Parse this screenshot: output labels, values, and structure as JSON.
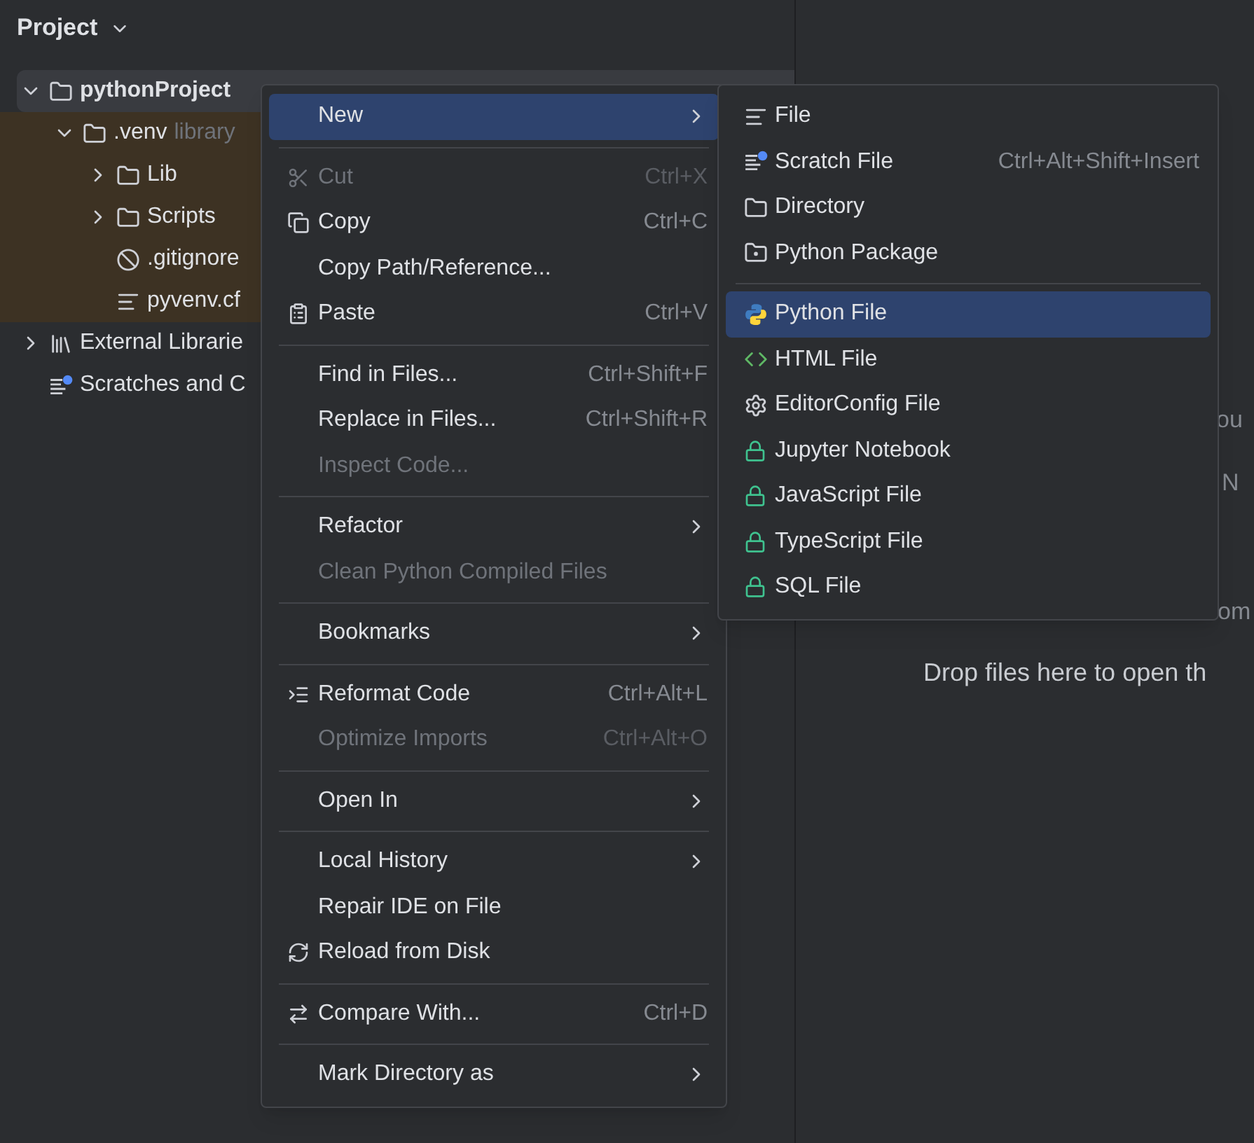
{
  "panel": {
    "title": "Project"
  },
  "tree": [
    {
      "label": "pythonProject",
      "kind": "folder",
      "expanded": true,
      "selected": true,
      "children": [
        {
          "label": ".venv",
          "hint": "library",
          "kind": "folder",
          "expanded": true,
          "selected": false,
          "excluded": true,
          "children": [
            {
              "label": "Lib",
              "kind": "folder",
              "expanded": false,
              "selected": false
            },
            {
              "label": "Scripts",
              "kind": "folder",
              "expanded": false,
              "selected": false
            },
            {
              "label": ".gitignore",
              "kind": "ignore",
              "selected": false
            },
            {
              "label": "pyvenv.cf",
              "kind": "text",
              "selected": false
            }
          ]
        }
      ]
    },
    {
      "label": "External Librarie",
      "kind": "library",
      "expanded": false,
      "selected": false
    },
    {
      "label": "Scratches and C",
      "kind": "scratch",
      "selected": false
    }
  ],
  "context_menu": [
    {
      "kind": "plain",
      "label": "New",
      "submenu": true,
      "disabled": false,
      "selected": true
    },
    {
      "kind": "separator"
    },
    {
      "kind": "cut",
      "label": "Cut",
      "shortcut": "Ctrl+X",
      "disabled": true,
      "selected": false
    },
    {
      "kind": "copy",
      "label": "Copy",
      "shortcut": "Ctrl+C",
      "disabled": false,
      "selected": false
    },
    {
      "kind": "plain",
      "label": "Copy Path/Reference...",
      "disabled": false,
      "selected": false
    },
    {
      "kind": "paste",
      "label": "Paste",
      "shortcut": "Ctrl+V",
      "disabled": false,
      "selected": false
    },
    {
      "kind": "separator"
    },
    {
      "kind": "plain",
      "label": "Find in Files...",
      "shortcut": "Ctrl+Shift+F",
      "disabled": false,
      "selected": false
    },
    {
      "kind": "plain",
      "label": "Replace in Files...",
      "shortcut": "Ctrl+Shift+R",
      "disabled": false,
      "selected": false
    },
    {
      "kind": "plain",
      "label": "Inspect Code...",
      "disabled": true,
      "selected": false
    },
    {
      "kind": "separator"
    },
    {
      "kind": "plain",
      "label": "Refactor",
      "submenu": true,
      "disabled": false,
      "selected": false
    },
    {
      "kind": "plain",
      "label": "Clean Python Compiled Files",
      "disabled": true,
      "selected": false
    },
    {
      "kind": "separator"
    },
    {
      "kind": "plain",
      "label": "Bookmarks",
      "submenu": true,
      "disabled": false,
      "selected": false
    },
    {
      "kind": "separator"
    },
    {
      "kind": "reformat",
      "label": "Reformat Code",
      "shortcut": "Ctrl+Alt+L",
      "disabled": false,
      "selected": false
    },
    {
      "kind": "plain",
      "label": "Optimize Imports",
      "shortcut": "Ctrl+Alt+O",
      "disabled": true,
      "selected": false
    },
    {
      "kind": "separator"
    },
    {
      "kind": "plain",
      "label": "Open In",
      "submenu": true,
      "disabled": false,
      "selected": false
    },
    {
      "kind": "separator"
    },
    {
      "kind": "plain",
      "label": "Local History",
      "submenu": true,
      "disabled": false,
      "selected": false
    },
    {
      "kind": "plain",
      "label": "Repair IDE on File",
      "disabled": false,
      "selected": false
    },
    {
      "kind": "reload",
      "label": "Reload from Disk",
      "disabled": false,
      "selected": false
    },
    {
      "kind": "separator"
    },
    {
      "kind": "compare",
      "label": "Compare With...",
      "shortcut": "Ctrl+D",
      "disabled": false,
      "selected": false
    },
    {
      "kind": "separator"
    },
    {
      "kind": "plain",
      "label": "Mark Directory as",
      "submenu": true,
      "disabled": false,
      "selected": false
    }
  ],
  "new_submenu": [
    {
      "kind": "text",
      "label": "File",
      "selected": false
    },
    {
      "kind": "scratch",
      "label": "Scratch File",
      "shortcut": "Ctrl+Alt+Shift+Insert",
      "selected": false
    },
    {
      "kind": "folder",
      "label": "Directory",
      "selected": false
    },
    {
      "kind": "package",
      "label": "Python Package",
      "selected": false
    },
    {
      "kind": "separator"
    },
    {
      "kind": "python",
      "label": "Python File",
      "selected": true
    },
    {
      "kind": "html",
      "label": "HTML File",
      "selected": false
    },
    {
      "kind": "gear",
      "label": "EditorConfig File",
      "selected": false
    },
    {
      "kind": "lock",
      "label": "Jupyter Notebook",
      "selected": false
    },
    {
      "kind": "lock",
      "label": "JavaScript File",
      "selected": false
    },
    {
      "kind": "lock",
      "label": "TypeScript File",
      "selected": false
    },
    {
      "kind": "lock",
      "label": "SQL File",
      "selected": false
    }
  ],
  "editor": {
    "hint_fragments": [
      "ou",
      "N",
      "om"
    ],
    "drop_hint": "Drop files here to open th"
  }
}
